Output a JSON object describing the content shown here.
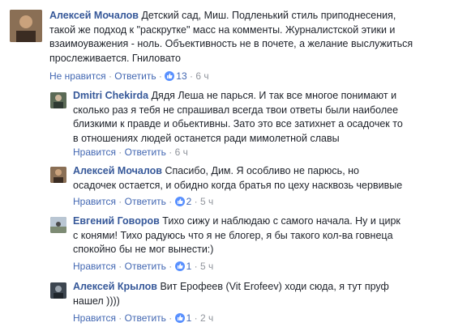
{
  "accent_color": "#4267b2",
  "name_color": "#365899",
  "comments": [
    {
      "author": "Алексей Мочалов",
      "lines": [
        "Детский сад, Миш. Подленький стиль приподнесения,",
        "такой же подход к \"раскрутке\" масс на комменты. Журналистской этики и",
        "взаимоуважения - ноль. Объективность не в почете, а желание выслужиться",
        "прослеживается. Гниловато"
      ],
      "like_label": "Не нравится",
      "reply_label": "Ответить",
      "likes": "13",
      "time": "6 ч"
    },
    {
      "author": "Dmitri Chekirda",
      "lines": [
        "Дядя Леша не парься. И так все многое понимают и",
        "сколько раз я тебя не спрашивал всегда твои ответы были наиболее",
        "близкими к правде и обьективны. Зато это все затихнет а осадочек то",
        "в отношениях людей останется ради мимолетной славы"
      ],
      "like_label": "Нравится",
      "reply_label": "Ответить",
      "likes": "",
      "time": "6 ч"
    },
    {
      "author": "Алексей Мочалов",
      "lines": [
        "Спасибо, Дим. Я особливо не парюсь, но",
        "осадочек остается, и обидно когда братья по цеху насквозь червивые"
      ],
      "like_label": "Нравится",
      "reply_label": "Ответить",
      "likes": "2",
      "time": "5 ч"
    },
    {
      "author": "Евгений Говоров",
      "lines": [
        "Тихо сижу и наблюдаю с самого начала. Ну и цирк",
        "с конями! Тихо радуюсь что я не блогер, я бы такого кол-ва говнеца",
        "спокойно бы не мог вынести:)"
      ],
      "like_label": "Нравится",
      "reply_label": "Ответить",
      "likes": "1",
      "time": "5 ч"
    },
    {
      "author": "Алексей Крылов",
      "lines": [
        "Вит Ерофеев (Vit Erofeev) ходи сюда, я тут пруф",
        "нашел ))))"
      ],
      "like_label": "Нравится",
      "reply_label": "Ответить",
      "likes": "1",
      "time": "2 ч"
    }
  ],
  "separator": "·",
  "icons": {
    "like": "thumbs-up-icon"
  }
}
